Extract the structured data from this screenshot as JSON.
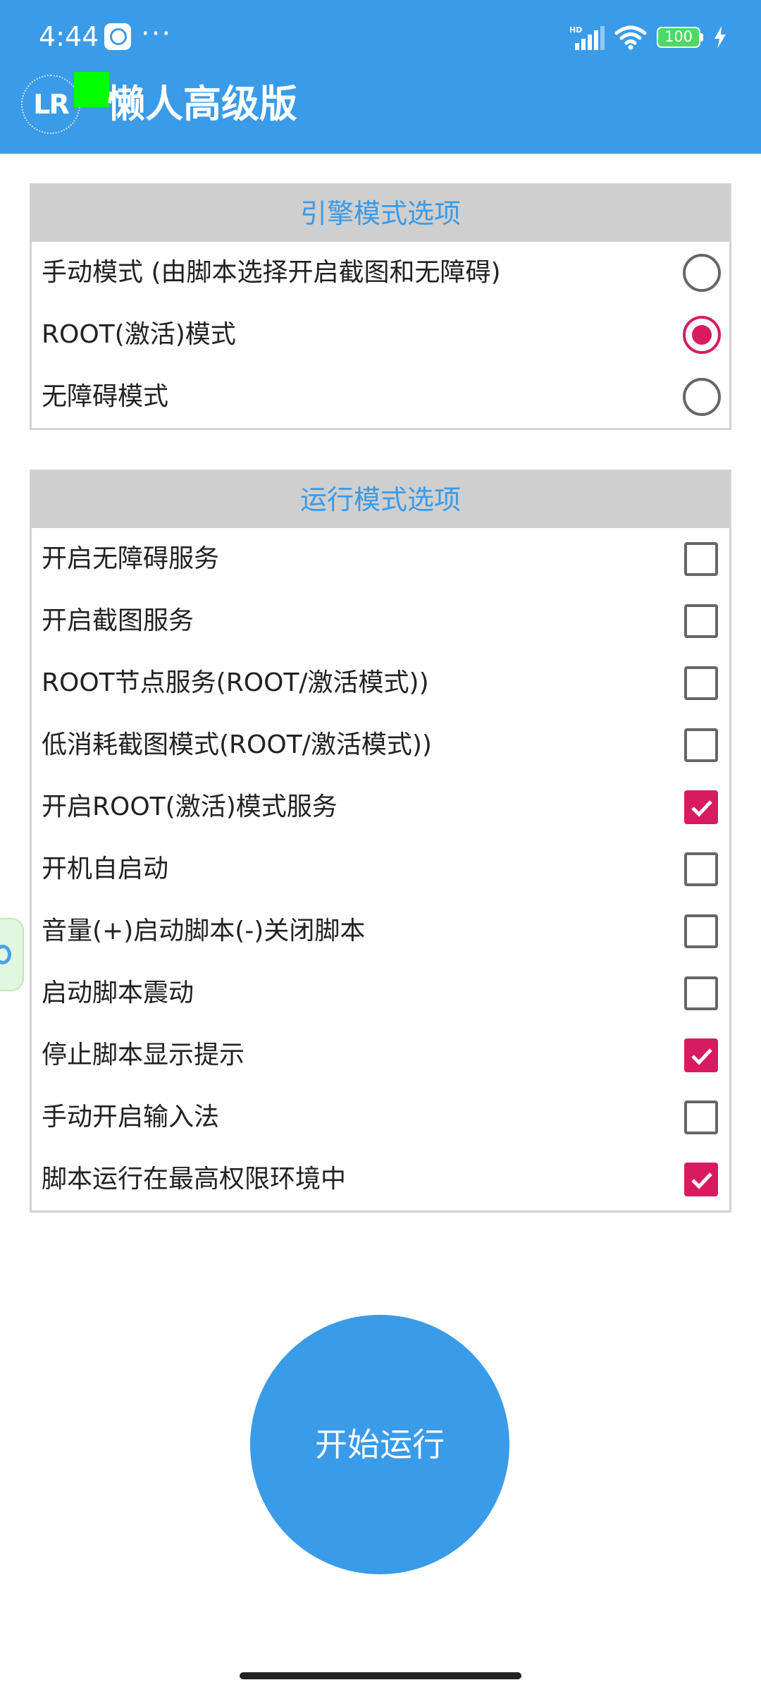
{
  "status_bar": {
    "time": "4:44",
    "dots": "···",
    "battery": "100"
  },
  "app_bar": {
    "logo_text": "LR",
    "title": "懒人高级版"
  },
  "engine_card": {
    "header": "引擎模式选项",
    "options": [
      {
        "label": "手动模式 (由脚本选择开启截图和无障碍)",
        "checked": false
      },
      {
        "label": "ROOT(激活)模式",
        "checked": true
      },
      {
        "label": "无障碍模式",
        "checked": false
      }
    ]
  },
  "run_card": {
    "header": "运行模式选项",
    "options": [
      {
        "label": "开启无障碍服务",
        "checked": false
      },
      {
        "label": "开启截图服务",
        "checked": false
      },
      {
        "label": "ROOT节点服务(ROOT/激活模式))",
        "checked": false
      },
      {
        "label": "低消耗截图模式(ROOT/激活模式))",
        "checked": false
      },
      {
        "label": "开启ROOT(激活)模式服务",
        "checked": true
      },
      {
        "label": "开机自启动",
        "checked": false
      },
      {
        "label": "音量(+)启动脚本(-)关闭脚本",
        "checked": false
      },
      {
        "label": "启动脚本震动",
        "checked": false
      },
      {
        "label": "停止脚本显示提示",
        "checked": true
      },
      {
        "label": "手动开启输入法",
        "checked": false
      },
      {
        "label": "脚本运行在最高权限环境中",
        "checked": true
      }
    ]
  },
  "start_button": {
    "label": "开始运行"
  },
  "colors": {
    "primary": "#3a9be8",
    "accent": "#d81b60",
    "header_gray": "#cfcfcf"
  }
}
